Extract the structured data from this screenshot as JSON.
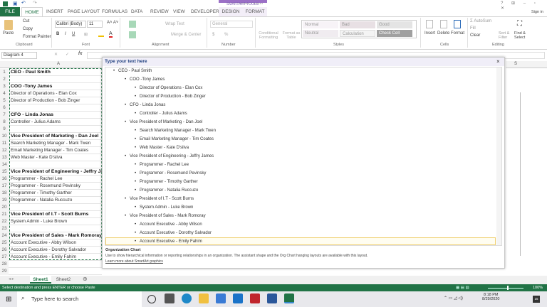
{
  "window": {
    "title": "Book1 - Excel",
    "contextual": "SMARTART TOOLS",
    "sign_in": "Sign in",
    "controls": [
      "?",
      "⊞",
      "—",
      "▫",
      "✕"
    ]
  },
  "tabs": [
    "FILE",
    "HOME",
    "INSERT",
    "PAGE LAYOUT",
    "FORMULAS",
    "DATA",
    "REVIEW",
    "VIEW",
    "DEVELOPER",
    "DESIGN",
    "FORMAT"
  ],
  "ribbon": {
    "clipboard": {
      "paste": "Paste",
      "cut": "Cut",
      "copy": "Copy",
      "format_painter": "Format Painter",
      "label": "Clipboard"
    },
    "font": {
      "name": "Calibri (Body)",
      "size": "11",
      "label": "Font",
      "bold": "B",
      "italic": "I",
      "underline": "U"
    },
    "alignment": {
      "wrap": "Wrap Text",
      "merge": "Merge & Center",
      "label": "Alignment"
    },
    "number": {
      "format": "General",
      "currency": "$",
      "percent": "%",
      "label": "Number"
    },
    "styles": {
      "conditional": "Conditional Formatting",
      "format_table": "Format as Table",
      "cells": [
        "Normal",
        "Bad",
        "Good",
        "Neutral",
        "Calculation",
        "Check Cell"
      ],
      "label": "Styles"
    },
    "cells": {
      "insert": "Insert",
      "delete": "Delete",
      "format": "Format",
      "label": "Cells"
    },
    "editing": {
      "autosum": "AutoSum",
      "fill": "Fill",
      "clear": "Clear",
      "sort": "Sort & Filter",
      "find": "Find & Select",
      "label": "Editing"
    }
  },
  "formula_bar": {
    "name_box": "Diagram 4",
    "fx": "fx"
  },
  "sheet": {
    "column": "A",
    "right_column": "S",
    "rows": [
      {
        "n": "1",
        "t": "CEO - Paul Smith",
        "b": true
      },
      {
        "n": "2",
        "t": ""
      },
      {
        "n": "3",
        "t": "COO -Tony James",
        "b": true
      },
      {
        "n": "4",
        "t": "Director of Operations - Elan Cox"
      },
      {
        "n": "5",
        "t": "Director of Production - Bob Zinger"
      },
      {
        "n": "6",
        "t": ""
      },
      {
        "n": "7",
        "t": "CFO - Linda Jonas",
        "b": true
      },
      {
        "n": "8",
        "t": "Controller - Julius Adams"
      },
      {
        "n": "9",
        "t": ""
      },
      {
        "n": "10",
        "t": "Vice President of Marketing - Dan Joel",
        "b": true
      },
      {
        "n": "11",
        "t": "Search Marketing Manager - Mark Twen"
      },
      {
        "n": "12",
        "t": "Email Marketing Manager - Tim Coates"
      },
      {
        "n": "13",
        "t": "Web Master - Kate D'silva"
      },
      {
        "n": "14",
        "t": ""
      },
      {
        "n": "15",
        "t": "Vice President of Engineering - Jeffry James",
        "b": true
      },
      {
        "n": "16",
        "t": "Programmer - Rachel Lee"
      },
      {
        "n": "17",
        "t": "Programmer - Rosemund Pevinsky"
      },
      {
        "n": "18",
        "t": "Programmer - Timothy Garther"
      },
      {
        "n": "19",
        "t": "Programmer - Natalia Ruccuzo"
      },
      {
        "n": "20",
        "t": ""
      },
      {
        "n": "21",
        "t": "Vice President of I.T - Scott Burns",
        "b": true
      },
      {
        "n": "22",
        "t": "System Admin - Luke Brown"
      },
      {
        "n": "23",
        "t": ""
      },
      {
        "n": "24",
        "t": "Vice President of Sales - Mark Romoray",
        "b": true
      },
      {
        "n": "25",
        "t": "Account Executive - Abby Wilson"
      },
      {
        "n": "26",
        "t": "Account Executive - Dorothy Salvador"
      },
      {
        "n": "27",
        "t": "Account Executive - Emily Fahim"
      },
      {
        "n": "28",
        "t": ""
      },
      {
        "n": "29",
        "t": ""
      }
    ]
  },
  "text_pane": {
    "title": "Type your text here",
    "items": [
      {
        "l": 1,
        "t": "CEO - Paul Smith"
      },
      {
        "l": 2,
        "t": "COO -Tony James"
      },
      {
        "l": 3,
        "t": "Director of Operations - Elan Cox"
      },
      {
        "l": 3,
        "t": "Director of Production - Bob Zinger"
      },
      {
        "l": 2,
        "t": "CFO - Linda Jonas"
      },
      {
        "l": 3,
        "t": "Controller - Julius Adams"
      },
      {
        "l": 2,
        "t": "Vice President of Marketing - Dan Joel"
      },
      {
        "l": 3,
        "t": "Search Marketing Manager - Mark Twen"
      },
      {
        "l": 3,
        "t": "Email Marketing Manager - Tim Coates"
      },
      {
        "l": 3,
        "t": "Web Master - Kate D'silva"
      },
      {
        "l": 2,
        "t": "Vice President of Engineering - Jeffry James"
      },
      {
        "l": 3,
        "t": "Programmer - Rachel Lee"
      },
      {
        "l": 3,
        "t": "Programmer - Rosemund Pevinsky"
      },
      {
        "l": 3,
        "t": "Programmer - Timothy Garther"
      },
      {
        "l": 3,
        "t": "Programmer - Natalia Ruccuzo"
      },
      {
        "l": 2,
        "t": "Vice President of I.T - Scott Burns"
      },
      {
        "l": 3,
        "t": "System Admin - Luke Brown"
      },
      {
        "l": 2,
        "t": "Vice President of Sales - Mark Romoray"
      },
      {
        "l": 3,
        "t": "Account Executive - Abby Wilson"
      },
      {
        "l": 3,
        "t": "Account Executive - Dorothy Salvador"
      },
      {
        "l": 3,
        "t": "Account Executive - Emily Fahim"
      }
    ],
    "layout_name": "Organization Chart",
    "description": "Use to show hierarchical information or reporting relationships in an organization. The assistant shape and the Org Chart hanging layouts are available with this layout.",
    "learn_more": "Learn more about SmartArt graphics"
  },
  "sheet_tabs": [
    "Sheet1",
    "Sheet2"
  ],
  "status": {
    "message": "Select destination and press ENTER or choose Paste",
    "zoom": "100%"
  },
  "taskbar": {
    "search_placeholder": "Type here to search",
    "time": "8:18 PM",
    "date": "8/29/2020",
    "notifications": "15"
  },
  "colors": {
    "excel_green": "#217346",
    "smartart": "#9b6fc6"
  }
}
